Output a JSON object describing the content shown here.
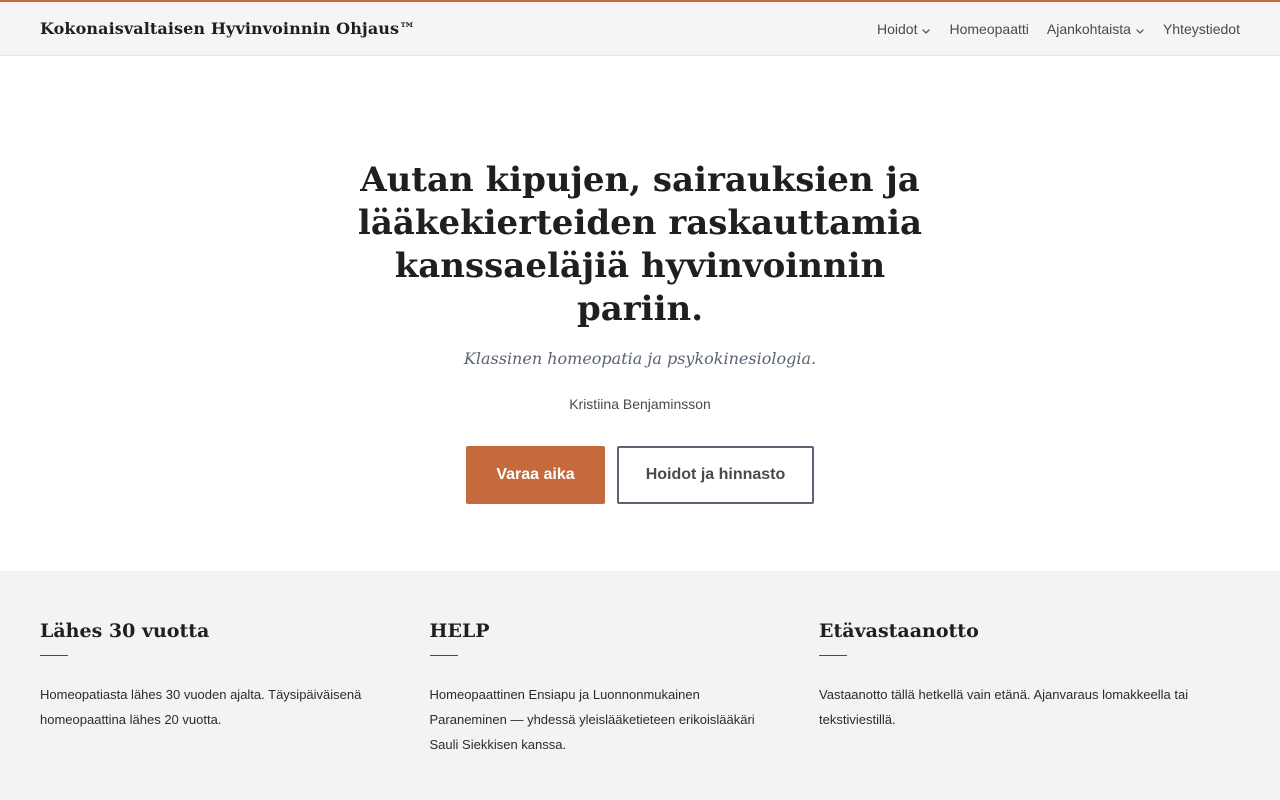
{
  "header": {
    "site_title": "Kokonaisvaltaisen Hyvinvoinnin Ohjaus™",
    "nav": [
      {
        "label": "Hoidot",
        "has_dropdown": true
      },
      {
        "label": "Homeopaatti",
        "has_dropdown": false
      },
      {
        "label": "Ajankohtaista",
        "has_dropdown": true
      },
      {
        "label": "Yhteystiedot",
        "has_dropdown": false
      }
    ]
  },
  "hero": {
    "title": "Autan kipujen, sairauksien ja lääkekierteiden raskauttamia kanssaeläjiä hyvinvoinnin pariin.",
    "subtitle": "Klassinen homeopatia ja psykokinesiologia.",
    "author": "Kristiina Benjaminsson",
    "primary_button": "Varaa aika",
    "secondary_button": "Hoidot ja hinnasto"
  },
  "features": [
    {
      "title": "Lähes 30 vuotta",
      "text": "Homeopatiasta lähes 30 vuoden ajalta. Täysipäiväisenä homeopaattina lähes 20 vuotta."
    },
    {
      "title": "HELP",
      "text": "Homeopaattinen Ensiapu ja Luonnonmukainen Paraneminen — yhdessä yleislääketieteen erikoislääkäri Sauli Siekkisen kanssa."
    },
    {
      "title": "Etävastaanotto",
      "text": "Vastaanotto tällä hetkellä vain etänä. Ajanvaraus lomakkeella tai tekstiviestillä."
    }
  ],
  "colors": {
    "accent": "#c56a3c",
    "header_bg": "#f5f5f5",
    "features_bg": "#f3f3f3",
    "rule": "#3b4b7a"
  },
  "icons": {
    "dropdown": "chevron-down-icon"
  }
}
